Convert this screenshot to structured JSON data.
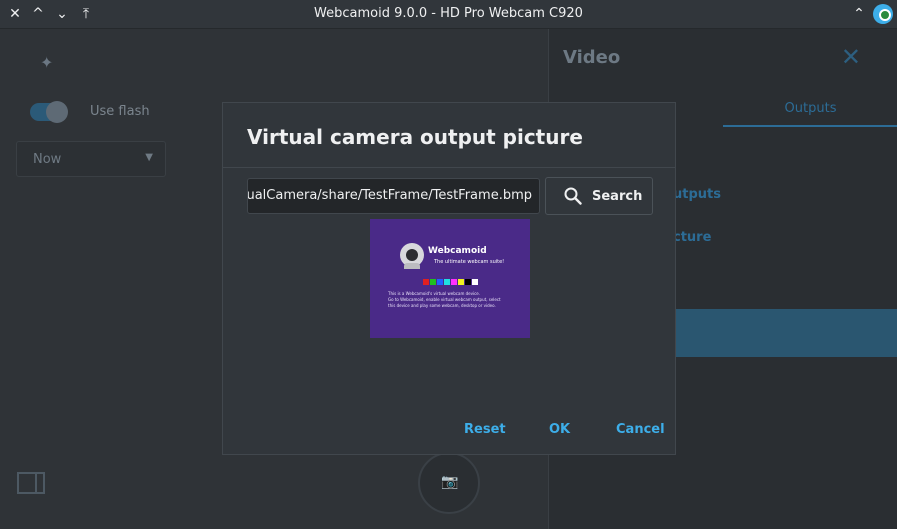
{
  "window": {
    "title": "Webcamoid 9.0.0 - HD Pro Webcam C920",
    "close_glyph": "✕",
    "minimize_glyph": "^",
    "maximize_glyph": "⌄",
    "shade_glyph": "⤒",
    "keep_above_glyph": "⌃",
    "app_icon": "webcamoid-icon"
  },
  "left_panel": {
    "flash_label": "Use flash",
    "flash_enabled": true,
    "timer_value": "Now"
  },
  "right_panel": {
    "title": "Video",
    "tab_outputs": "Outputs",
    "item_outputs_partial": "utputs",
    "item_picture_partial": "cture"
  },
  "dialog": {
    "title": "Virtual camera output picture",
    "path_value": "tualCamera/share/TestFrame/TestFrame.bmp",
    "search_label": "Search",
    "reset_label": "Reset",
    "ok_label": "OK",
    "cancel_label": "Cancel",
    "preview": {
      "brand": "Webcamoid",
      "tagline": "The ultimate webcam suite!",
      "line1": "This is a Webcamoid's virtual webcam device.",
      "line2": "Go to Webcamoid, enable virtual webcam output, select",
      "line3": "this device and play some webcam, desktop or video.",
      "bar_colors": [
        "#e02020",
        "#20c020",
        "#2060ff",
        "#20e0e0",
        "#ff30ff",
        "#f0f020",
        "#000000",
        "#ffffff"
      ]
    }
  },
  "colors": {
    "accent": "#3daee9",
    "background": "#31363b",
    "preview_bg": "#4a2a88"
  }
}
